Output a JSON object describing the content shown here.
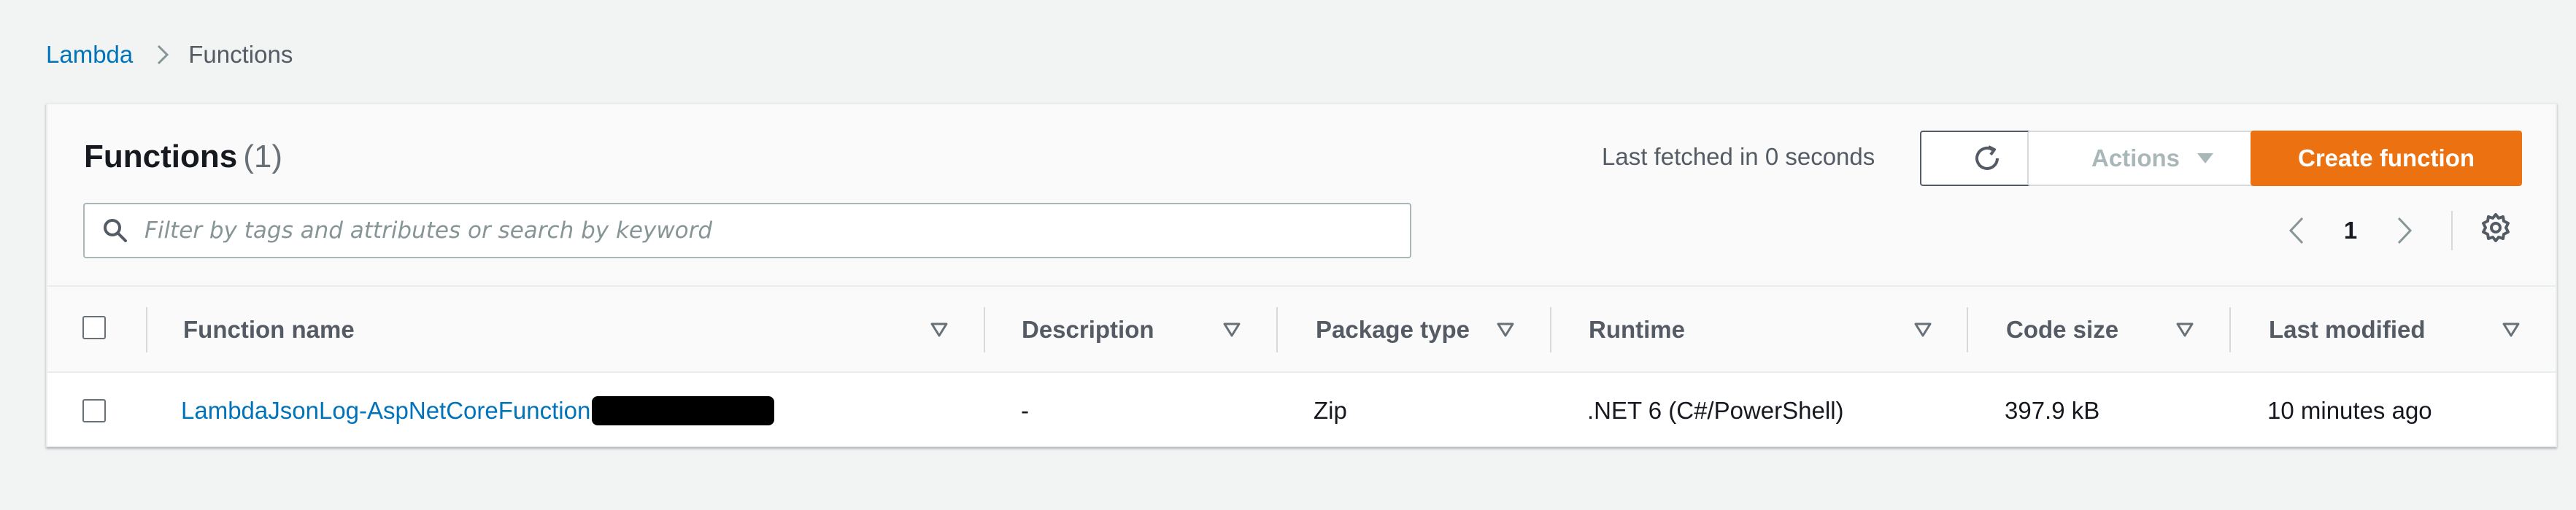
{
  "breadcrumb": {
    "root": "Lambda",
    "current": "Functions"
  },
  "panel": {
    "title": "Functions",
    "count": "(1)",
    "last_fetched": "Last fetched in 0 seconds",
    "actions_label": "Actions",
    "create_label": "Create function",
    "search_placeholder": "Filter by tags and attributes or search by keyword",
    "page": "1"
  },
  "table": {
    "columns": [
      "Function name",
      "Description",
      "Package type",
      "Runtime",
      "Code size",
      "Last modified"
    ],
    "rows": [
      {
        "function_name": "LambdaJsonLog-AspNetCoreFunction",
        "description": "-",
        "package_type": "Zip",
        "runtime": ".NET 6 (C#/PowerShell)",
        "code_size": "397.9 kB",
        "last_modified": "10 minutes ago"
      }
    ]
  },
  "colors": {
    "link": "#0073bb",
    "primary": "#ec7211",
    "background": "#f2f3f3"
  },
  "icons": [
    "chevron-right-icon",
    "refresh-icon",
    "caret-down-icon",
    "search-icon",
    "chevron-left-icon",
    "gear-icon",
    "sort-icon"
  ]
}
